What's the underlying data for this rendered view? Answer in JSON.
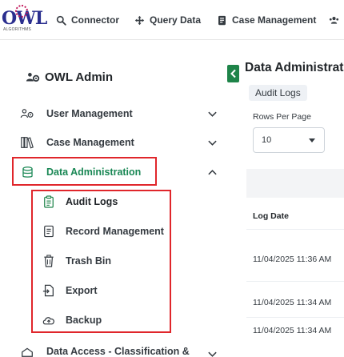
{
  "header": {
    "logo_text": "OWL",
    "logo_subtext": "ALGORITHMS",
    "nav": [
      {
        "label": "Connector",
        "icon": "search-icon"
      },
      {
        "label": "Query Data",
        "icon": "move-arrows-icon"
      },
      {
        "label": "Case Management",
        "icon": "document-icon"
      },
      {
        "label": "",
        "icon": "users-icon"
      }
    ]
  },
  "sidebar": {
    "title": "OWL Admin",
    "items": [
      {
        "label": "User Management",
        "icon": "users-cog-icon",
        "expanded": false
      },
      {
        "label": "Case Management",
        "icon": "books-icon",
        "expanded": false
      },
      {
        "label": "Data Administration",
        "icon": "database-icon",
        "expanded": true,
        "active": true
      },
      {
        "label": "Data Access - Classification &",
        "icon": "shield-icon",
        "expanded": false
      }
    ],
    "subitems": [
      {
        "label": "Audit Logs",
        "icon": "clipboard-list-icon",
        "active": true
      },
      {
        "label": "Record Management",
        "icon": "file-list-icon"
      },
      {
        "label": "Trash Bin",
        "icon": "trash-icon"
      },
      {
        "label": "Export",
        "icon": "file-export-icon"
      },
      {
        "label": "Backup",
        "icon": "cloud-upload-icon"
      }
    ]
  },
  "main": {
    "title": "Data Administrati",
    "tab": "Audit Logs",
    "rows_label": "Rows Per Page",
    "rows_value": "10",
    "column_header": "Log Date",
    "rows": [
      "11/04/2025 11:36 AM",
      "11/04/2025 11:34 AM",
      "11/04/2025 11:34 AM"
    ]
  },
  "colors": {
    "accent": "#1e8449",
    "highlight": "#e0262b"
  }
}
